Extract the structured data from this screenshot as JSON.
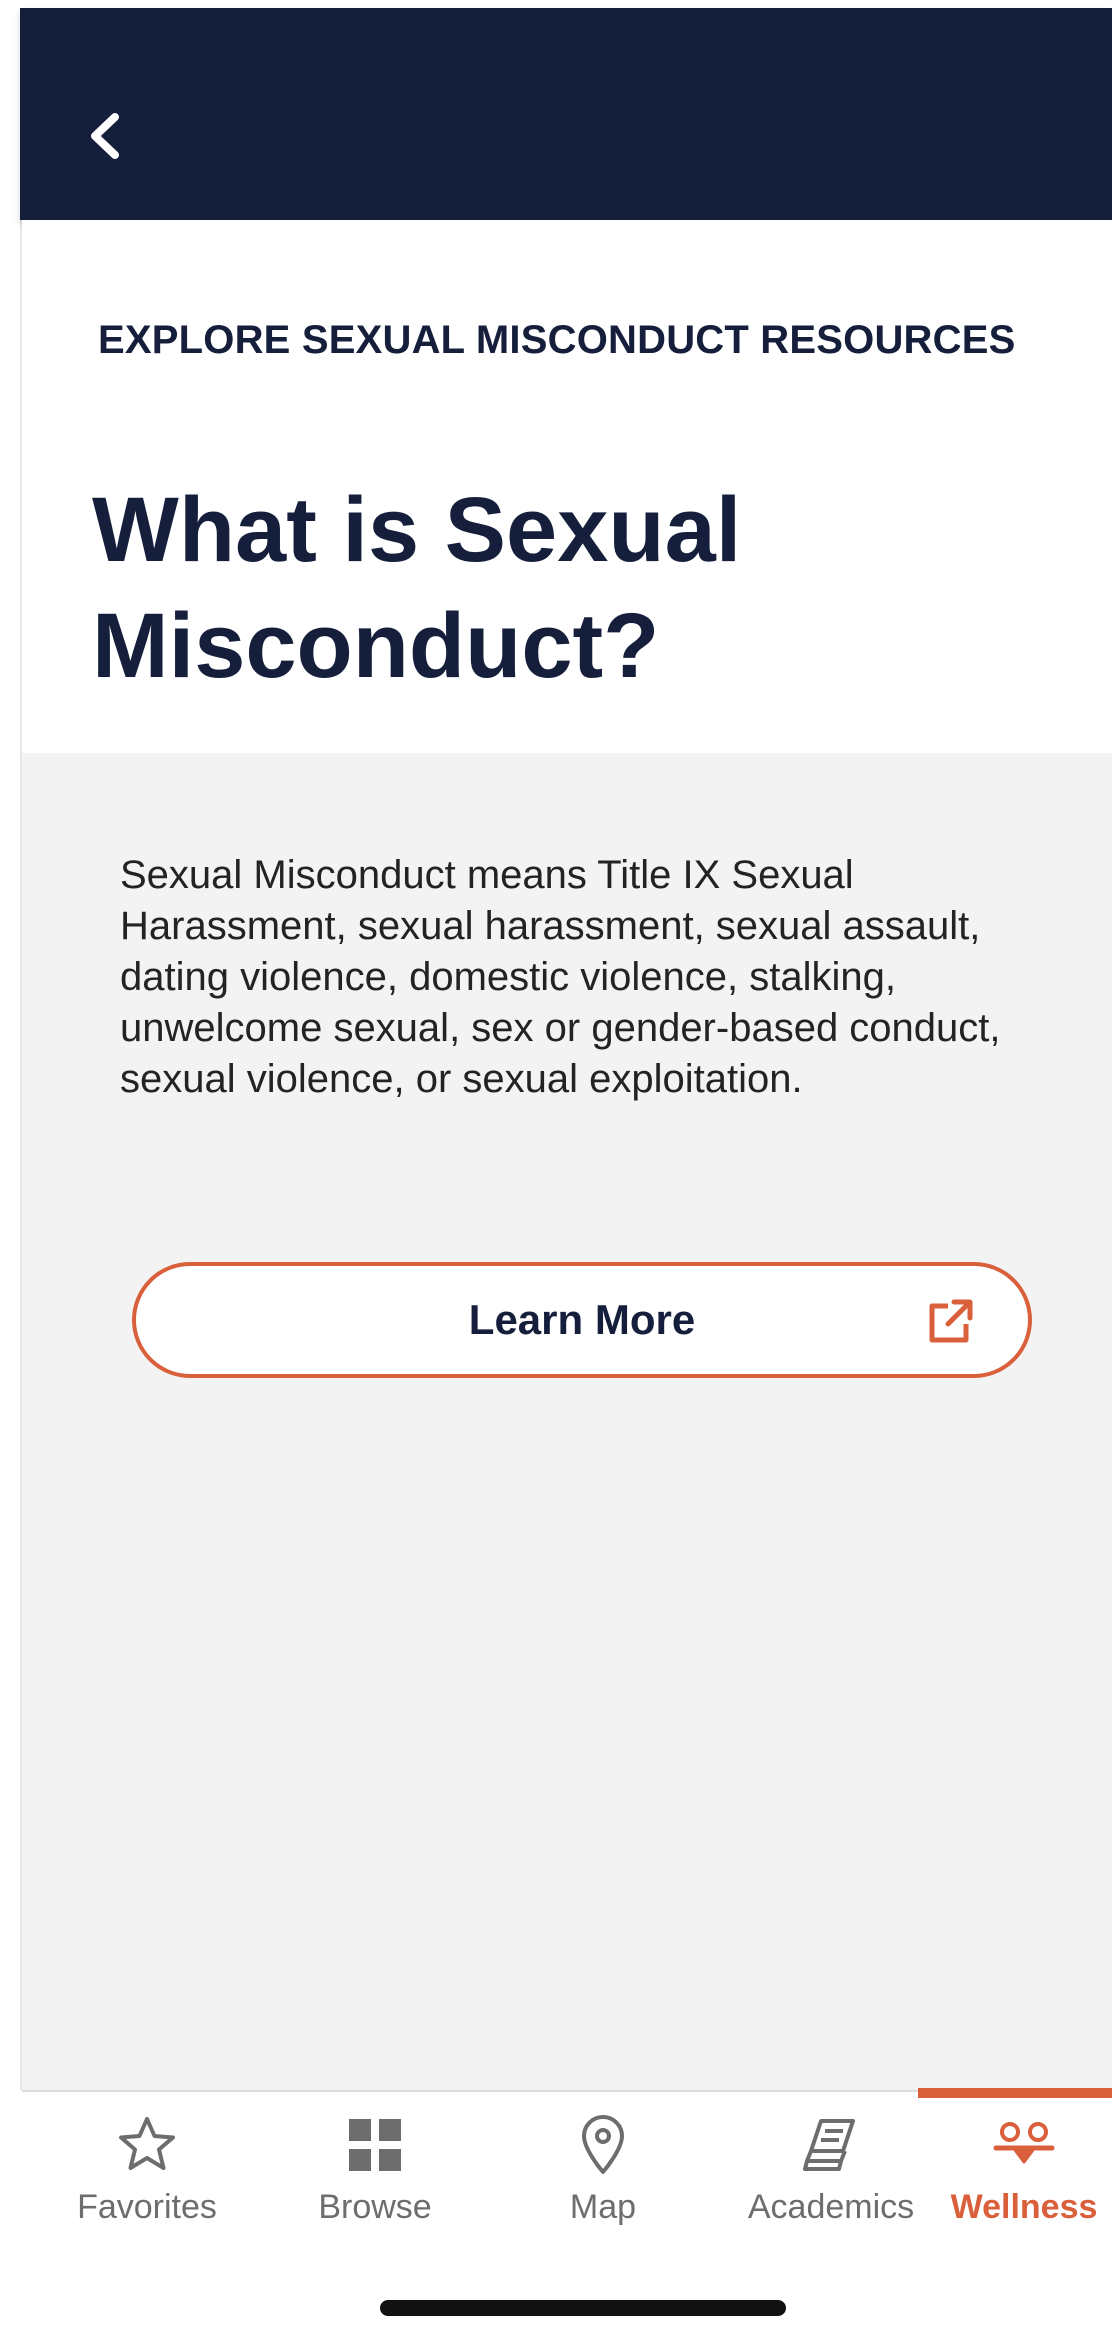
{
  "header": {
    "back_icon": "chevron-left-icon",
    "background_color": "#151f3c"
  },
  "hero": {
    "kicker": "EXPLORE SEXUAL MISCONDUCT RESOURCES",
    "title": "What is Sexual Misconduct?"
  },
  "content": {
    "body": "Sexual Misconduct means Title IX Sexual Harassment, sexual harassment, sexual assault, dating violence, domestic violence, stalking, unwelcome sexual, sex or gender-based conduct, sexual violence, or sexual exploitation.",
    "learn_more_label": "Learn More",
    "learn_more_icon": "external-link-icon",
    "accent_color": "#d9603b"
  },
  "tabbar": {
    "tabs": [
      {
        "label": "Favorites",
        "icon": "star-icon",
        "active": false
      },
      {
        "label": "Browse",
        "icon": "grid-icon",
        "active": false
      },
      {
        "label": "Map",
        "icon": "map-pin-icon",
        "active": false
      },
      {
        "label": "Academics",
        "icon": "books-icon",
        "active": false
      },
      {
        "label": "Wellness",
        "icon": "wellness-icon",
        "active": true
      }
    ]
  }
}
